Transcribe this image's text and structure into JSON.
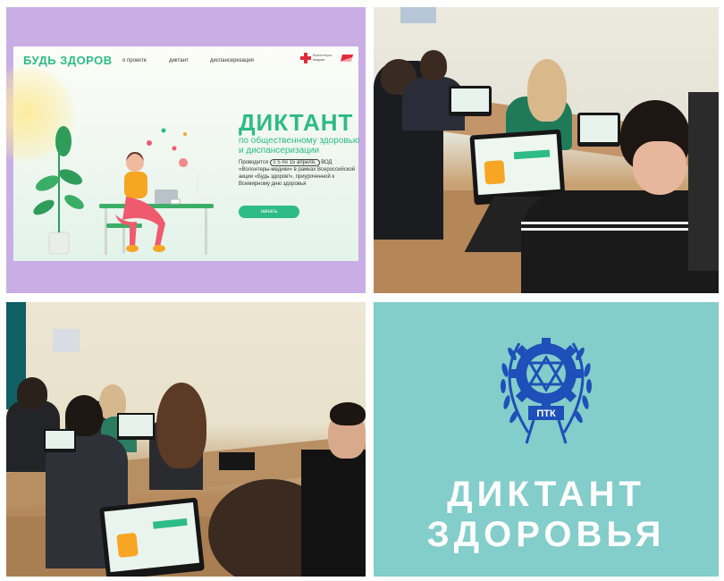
{
  "site": {
    "brand": "БУДЬ ЗДОРОВ",
    "nav": [
      "о проекте",
      "диктант",
      "диспансеризация"
    ],
    "partner": "Волонтеры-медики",
    "headline": "ДИКТАНТ",
    "subheadline": "по общественному здоровью и диспансеризации",
    "description_prefix": "Проводится",
    "dates": "с 5 по 15 апреля,",
    "description_rest": "ВОД «Волонтеры-медики» в рамках Всероссийской акции «Будь здоров!», приуроченной к Всемирному дню здоровья",
    "button": "начать"
  },
  "logo": {
    "emblem_text": "ПТК"
  },
  "caption": {
    "line1": "ДИКТАНТ",
    "line2": "ЗДОРОВЬЯ"
  },
  "colors": {
    "accent_green": "#2dbb86",
    "frame_purple": "#c9aee6",
    "teal_background": "#83cdca",
    "logo_blue": "#1f4fb8"
  }
}
